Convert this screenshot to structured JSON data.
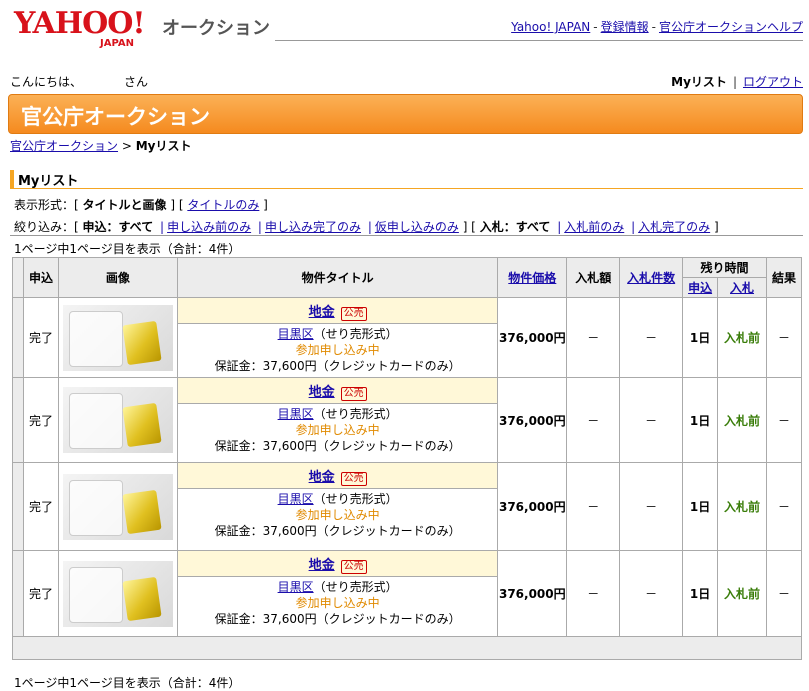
{
  "header": {
    "logo_main": "YAHOO!",
    "logo_sub": "JAPAN",
    "service_name": "オークション",
    "links": [
      "Yahoo! JAPAN",
      "登録情報",
      "官公庁オークションヘルプ"
    ],
    "link_sep": "-"
  },
  "user": {
    "greeting": "こんにちは、　　　　さん",
    "mylist": "Myリスト",
    "logout": "ログアウト",
    "sep": "|"
  },
  "banner": {
    "title": "官公庁オークション"
  },
  "breadcrumb": {
    "parent": "官公庁オークション",
    "sep": ">",
    "current": "Myリスト"
  },
  "section": {
    "title": "Myリスト"
  },
  "display_format": {
    "label": "表示形式：",
    "active": "タイトルと画像",
    "option": "タイトルのみ"
  },
  "filter": {
    "label": "絞り込み：",
    "apply_active": "申込：すべて",
    "apply_options": [
      "申し込み前のみ",
      "申し込み完了のみ",
      "仮申し込みのみ"
    ],
    "bid_active": "入札：すべて",
    "bid_options": [
      "入札前のみ",
      "入札完了のみ"
    ]
  },
  "page_info": "1ページ中1ページ目を表示（合計：4件）",
  "table": {
    "headers": {
      "apply": "申込",
      "image": "画像",
      "title": "物件タイトル",
      "price": "物件価格",
      "bid_amount": "入札額",
      "bid_count": "入札件数",
      "remaining": "残り時間",
      "remaining_apply": "申込",
      "remaining_bid": "入札",
      "result": "結果"
    },
    "rows": [
      {
        "status": "完了",
        "title": "地金",
        "tag": "公売",
        "location": "目黒区",
        "format": "（せり売形式）",
        "phase": "参加申し込み中",
        "deposit": "保証金：37,600円（クレジットカードのみ）",
        "price": "376,000円",
        "bid_amount": "－",
        "bid_count": "－",
        "remain_apply": "1日",
        "remain_bid": "入札前",
        "result": "－"
      },
      {
        "status": "完了",
        "title": "地金",
        "tag": "公売",
        "location": "目黒区",
        "format": "（せり売形式）",
        "phase": "参加申し込み中",
        "deposit": "保証金：37,600円（クレジットカードのみ）",
        "price": "376,000円",
        "bid_amount": "－",
        "bid_count": "－",
        "remain_apply": "1日",
        "remain_bid": "入札前",
        "result": "－"
      },
      {
        "status": "完了",
        "title": "地金",
        "tag": "公売",
        "location": "目黒区",
        "format": "（せり売形式）",
        "phase": "参加申し込み中",
        "deposit": "保証金：37,600円（クレジットカードのみ）",
        "price": "376,000円",
        "bid_amount": "－",
        "bid_count": "－",
        "remain_apply": "1日",
        "remain_bid": "入札前",
        "result": "－"
      },
      {
        "status": "完了",
        "title": "地金",
        "tag": "公売",
        "location": "目黒区",
        "format": "（せり売形式）",
        "phase": "参加申し込み中",
        "deposit": "保証金：37,600円（クレジットカードのみ）",
        "price": "376,000円",
        "bid_amount": "－",
        "bid_count": "－",
        "remain_apply": "1日",
        "remain_bid": "入札前",
        "result": "－"
      }
    ]
  }
}
